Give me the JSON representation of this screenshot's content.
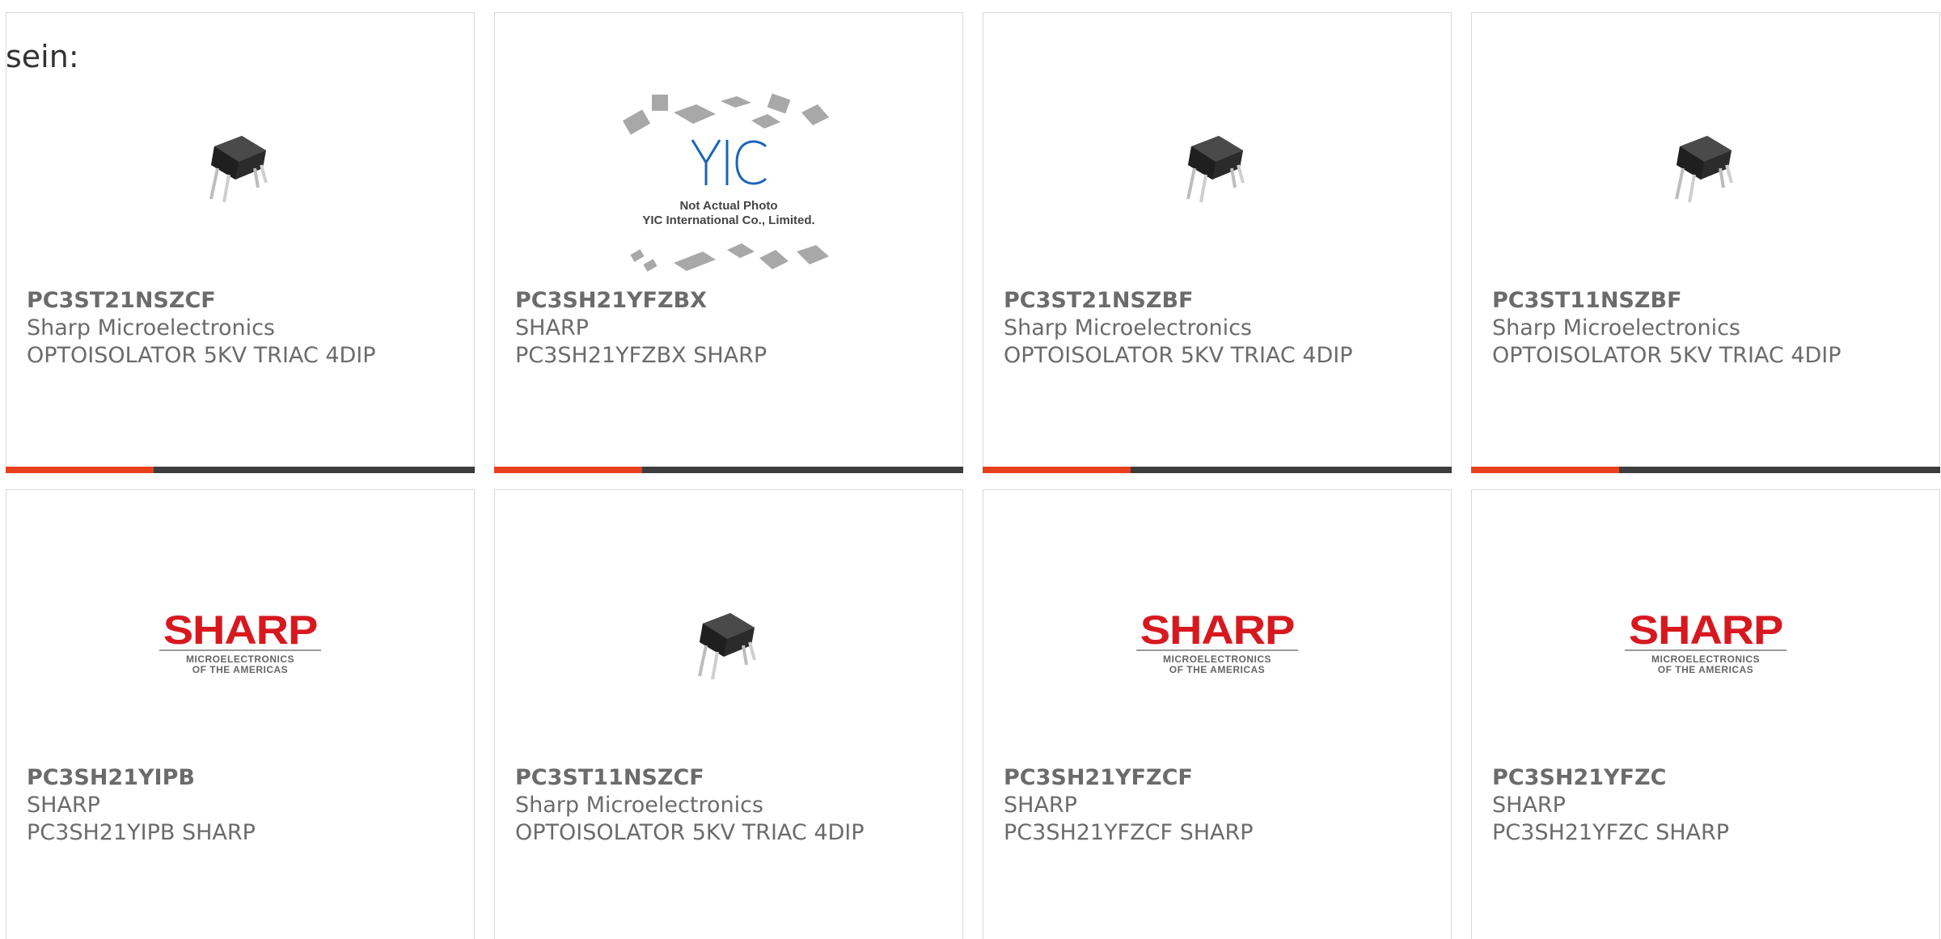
{
  "intro_text": "sein:",
  "colors": {
    "accent": "#e8401c",
    "bar": "#3d3d3d",
    "text": "#6b6b6b",
    "sharp_red": "#d7191f"
  },
  "products": [
    {
      "part": "PC3ST21NSZCF",
      "maker": "Sharp Microelectronics",
      "description": "OPTOISOLATOR 5KV TRIAC 4DIP",
      "image": "optocoupler-dip-icon",
      "has_bar": true
    },
    {
      "part": "PC3SH21YFZBX",
      "maker": "SHARP",
      "description": "PC3SH21YFZBX SHARP",
      "image": "yic-placeholder",
      "image_caption_1": "Not Actual Photo",
      "image_caption_2": "YIC International Co., Limited.",
      "image_logo": "YIC",
      "has_bar": true
    },
    {
      "part": "PC3ST21NSZBF",
      "maker": "Sharp Microelectronics",
      "description": "OPTOISOLATOR 5KV TRIAC 4DIP",
      "image": "optocoupler-dip-icon",
      "has_bar": true
    },
    {
      "part": "PC3ST11NSZBF",
      "maker": "Sharp Microelectronics",
      "description": "OPTOISOLATOR 5KV TRIAC 4DIP",
      "image": "optocoupler-dip-icon",
      "has_bar": true
    },
    {
      "part": "PC3SH21YIPB",
      "maker": "SHARP",
      "description": "PC3SH21YIPB SHARP",
      "image": "sharp-logo",
      "logo_word": "SHARP",
      "logo_sub_1": "MICROELECTRONICS",
      "logo_sub_2": "OF THE AMERICAS",
      "has_bar": false
    },
    {
      "part": "PC3ST11NSZCF",
      "maker": "Sharp Microelectronics",
      "description": "OPTOISOLATOR 5KV TRIAC 4DIP",
      "image": "optocoupler-dip-icon",
      "has_bar": false
    },
    {
      "part": "PC3SH21YFZCF",
      "maker": "SHARP",
      "description": "PC3SH21YFZCF SHARP",
      "image": "sharp-logo",
      "logo_word": "SHARP",
      "logo_sub_1": "MICROELECTRONICS",
      "logo_sub_2": "OF THE AMERICAS",
      "has_bar": false
    },
    {
      "part": "PC3SH21YFZC",
      "maker": "SHARP",
      "description": "PC3SH21YFZC SHARP",
      "image": "sharp-logo",
      "logo_word": "SHARP",
      "logo_sub_1": "MICROELECTRONICS",
      "logo_sub_2": "OF THE AMERICAS",
      "has_bar": false
    }
  ]
}
